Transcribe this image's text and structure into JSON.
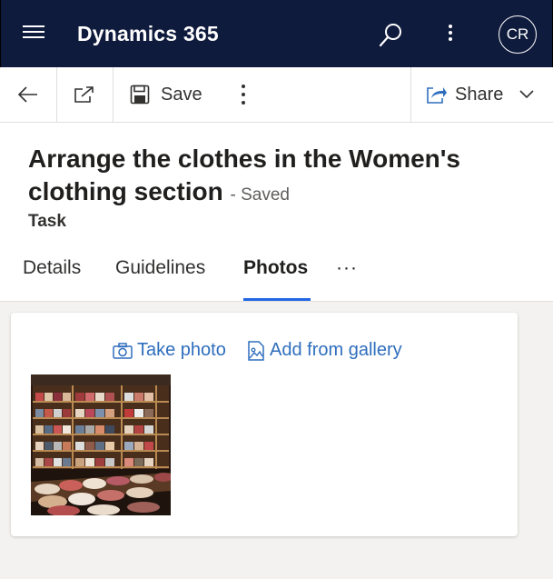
{
  "app": {
    "title": "Dynamics 365",
    "user_initials": "CR"
  },
  "commandbar": {
    "save_label": "Save",
    "share_label": "Share"
  },
  "record": {
    "title": "Arrange the clothes in the Women's clothing section",
    "status": "- Saved",
    "entity": "Task"
  },
  "tabs": [
    {
      "label": "Details",
      "active": false
    },
    {
      "label": "Guidelines",
      "active": false
    },
    {
      "label": "Photos",
      "active": true
    }
  ],
  "tabs_more": "···",
  "photos": {
    "take_photo_label": "Take photo",
    "add_gallery_label": "Add from gallery",
    "items": [
      {
        "subject": "clothing store shelves"
      }
    ]
  },
  "colors": {
    "topbar": "#0f1b3d",
    "accent": "#2266e3",
    "link": "#2f6ebd"
  }
}
